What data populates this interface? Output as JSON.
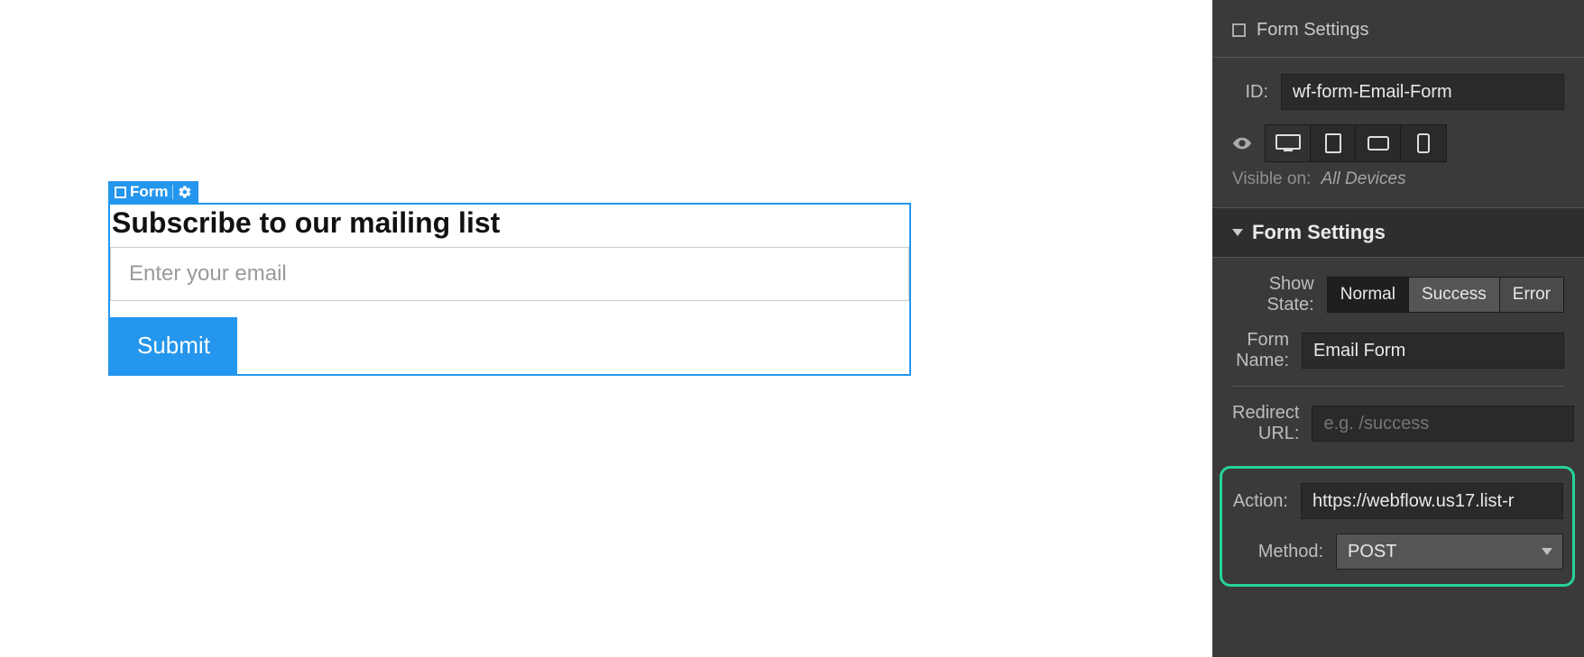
{
  "canvas": {
    "selection_label": "Form",
    "form": {
      "heading": "Subscribe to our mailing list",
      "email_placeholder": "Enter your email",
      "submit_label": "Submit"
    }
  },
  "panel": {
    "header_title": "Form Settings",
    "id_label": "ID:",
    "id_value": "wf-form-Email-Form",
    "visible_on_label": "Visible on:",
    "visible_on_value": "All Devices",
    "section_title": "Form Settings",
    "show_state_label": "Show State:",
    "show_state_options": {
      "normal": "Normal",
      "success": "Success",
      "error": "Error"
    },
    "form_name_label": "Form Name:",
    "form_name_value": "Email Form",
    "redirect_label": "Redirect URL:",
    "redirect_placeholder": "e.g. /success",
    "action_label": "Action:",
    "action_value": "https://webflow.us17.list-r",
    "method_label": "Method:",
    "method_value": "POST"
  },
  "icons": {
    "form": "form-square-icon",
    "gear": "gear-icon",
    "eye": "visibility-eye-icon",
    "desktop": "device-desktop-icon",
    "tablet": "device-tablet-icon",
    "landscape": "device-landscape-icon",
    "phone": "device-phone-icon",
    "caret": "caret-down-icon"
  },
  "colors": {
    "accent": "#2496ed",
    "highlight": "#26d39a",
    "panel_bg": "#3a3a3a",
    "input_dark": "#2a2a2a"
  }
}
